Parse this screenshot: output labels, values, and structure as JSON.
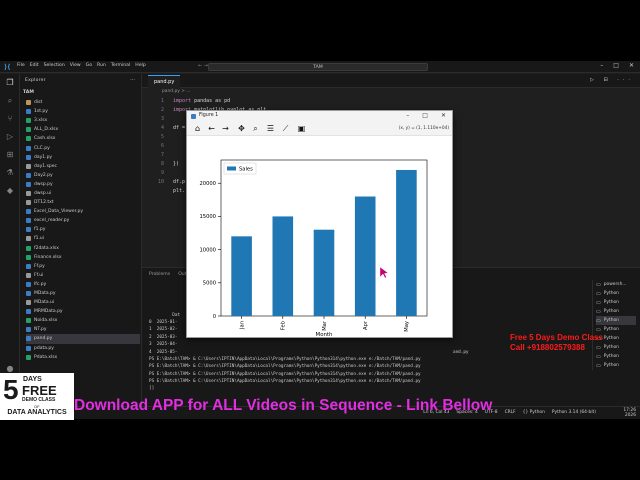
{
  "window": {
    "menu": [
      "File",
      "Edit",
      "Selection",
      "View",
      "Go",
      "Run",
      "Terminal",
      "Help"
    ],
    "command_center": "TAM"
  },
  "explorer": {
    "title": "Explorer",
    "folder": "TAM",
    "files": [
      {
        "name": "dist",
        "icon_color": "#c09553"
      },
      {
        "name": "1st.py",
        "icon_color": "#3b7dc4"
      },
      {
        "name": "3.xlsx",
        "icon_color": "#21a366"
      },
      {
        "name": "ALL_D.xlsx",
        "icon_color": "#21a366"
      },
      {
        "name": "Cash.xlsx",
        "icon_color": "#21a366"
      },
      {
        "name": "CLC.py",
        "icon_color": "#3b7dc4"
      },
      {
        "name": "day1.py",
        "icon_color": "#3b7dc4"
      },
      {
        "name": "day1.spec",
        "icon_color": "#999999"
      },
      {
        "name": "Day2.py",
        "icon_color": "#3b7dc4"
      },
      {
        "name": "dwsp.py",
        "icon_color": "#3b7dc4"
      },
      {
        "name": "dwsp.ui",
        "icon_color": "#999999"
      },
      {
        "name": "DT12.txt",
        "icon_color": "#999999"
      },
      {
        "name": "Excel_Data_Viewer.py",
        "icon_color": "#3b7dc4"
      },
      {
        "name": "excel_reader.py",
        "icon_color": "#3b7dc4"
      },
      {
        "name": "f1.py",
        "icon_color": "#3b7dc4"
      },
      {
        "name": "f1.ui",
        "icon_color": "#999999"
      },
      {
        "name": "f2data.xlsx",
        "icon_color": "#21a366"
      },
      {
        "name": "Finance.xlsx",
        "icon_color": "#21a366"
      },
      {
        "name": "Ff.py",
        "icon_color": "#3b7dc4"
      },
      {
        "name": "Ff.ui",
        "icon_color": "#999999"
      },
      {
        "name": "lfc.py",
        "icon_color": "#3b7dc4"
      },
      {
        "name": "MData.py",
        "icon_color": "#3b7dc4"
      },
      {
        "name": "MData.ui",
        "icon_color": "#999999"
      },
      {
        "name": "MRMData.py",
        "icon_color": "#3b7dc4"
      },
      {
        "name": "Noida.xlsx",
        "icon_color": "#21a366"
      },
      {
        "name": "NT.py",
        "icon_color": "#3b7dc4"
      },
      {
        "name": "pand.py",
        "icon_color": "#3b7dc4"
      },
      {
        "name": "pdata.py",
        "icon_color": "#3b7dc4"
      },
      {
        "name": "Pdata.xlsx",
        "icon_color": "#21a366"
      }
    ],
    "active_file": "pand.py",
    "outline": "Outline"
  },
  "editor": {
    "tab": "pand.py",
    "breadcrumb": "pand.py > ...",
    "line_numbers": [
      "1",
      "2",
      "3",
      "4",
      "5",
      "6",
      "7",
      "8",
      "9",
      "10"
    ],
    "lines": [
      {
        "kw": "import",
        "rest": " pandas as pd"
      },
      {
        "kw": "import",
        "rest": " matplotlib.pyplot as plt"
      },
      {
        "kw": "",
        "rest": ""
      },
      {
        "kw": "",
        "rest": "df ="
      },
      {
        "kw": "",
        "rest": ""
      },
      {
        "kw": "",
        "rest": ""
      },
      {
        "kw": "",
        "rest": ""
      },
      {
        "kw": "",
        "rest": "})"
      },
      {
        "kw": "",
        "rest": ""
      },
      {
        "kw": "",
        "rest": "df.p"
      },
      {
        "kw": "",
        "rest": "plt."
      }
    ]
  },
  "panel": {
    "tabs": [
      "Problems",
      "Output"
    ],
    "terminal_lines": [
      "",
      "",
      "",
      "",
      "         Dat",
      "0  2025-01-",
      "1  2025-02-",
      "2  2025-03-",
      "3  2025-04-",
      "4  2025-05-",
      "PS E:\\Batch\\TAM> & C:\\Users\\IPTIN\\AppData\\Local\\Programs\\Python\\Python314\\python.exe e:/Batch/TAM/pand.py",
      "PS E:\\Batch\\TAM> & C:\\Users\\IPTIN\\AppData\\Local\\Programs\\Python\\Python314\\python.exe e:/Batch/TAM/pand.py",
      "PS E:\\Batch\\TAM> & C:\\Users\\IPTIN\\AppData\\Local\\Programs\\Python\\Python314\\python.exe e:/Batch/TAM/pand.py",
      "PS E:\\Batch\\TAM> & C:\\Users\\IPTIN\\AppData\\Local\\Programs\\Python\\Python314\\python.exe e:/Batch/TAM/pand.py",
      "[]"
    ],
    "terminal_suffix": "and.py",
    "terminals": [
      "powersh...",
      "Python",
      "Python",
      "Python",
      "Python",
      "Python",
      "Python",
      "Python",
      "Python",
      "Python"
    ]
  },
  "statusbar": {
    "items": [
      "Ln 6, Col 43",
      "Spaces: 4",
      "UTF-8",
      "CRLF",
      "{} Python",
      "Python 3.14 (64-bit)"
    ],
    "clock_time": "17:26",
    "clock_date": "2026"
  },
  "figure": {
    "title": "Figure 1",
    "coords": "(x, y) = (1, 1.110e+04)",
    "tool_icons": [
      "home-icon",
      "back-icon",
      "forward-icon",
      "pan-icon",
      "zoom-icon",
      "configure-icon",
      "edit-icon",
      "save-icon"
    ]
  },
  "chart_data": {
    "type": "bar",
    "categories": [
      "Jan",
      "Feb",
      "Mar",
      "Apr",
      "May"
    ],
    "series": [
      {
        "name": "Sales",
        "values": [
          12000,
          15000,
          13000,
          18000,
          22000
        ],
        "color": "#1f77b4"
      }
    ],
    "title": "",
    "xlabel": "Month",
    "ylabel": "",
    "ylim": [
      0,
      23500
    ],
    "yticks": [
      0,
      5000,
      10000,
      15000,
      20000
    ],
    "legend": "top-left",
    "grid": false
  },
  "overlay": {
    "promo_line1": "Free 5 Days  Demo Class",
    "promo_line2": "Call +918802579388",
    "badge_num": "5",
    "badge_days": "DAYS",
    "badge_free": "FREE",
    "badge_demo": "DEMO CLASS",
    "badge_of": "OF",
    "badge_subject": "DATA ANALYTICS",
    "banner": "Download APP for ALL Videos in Sequence - Link Bellow"
  }
}
